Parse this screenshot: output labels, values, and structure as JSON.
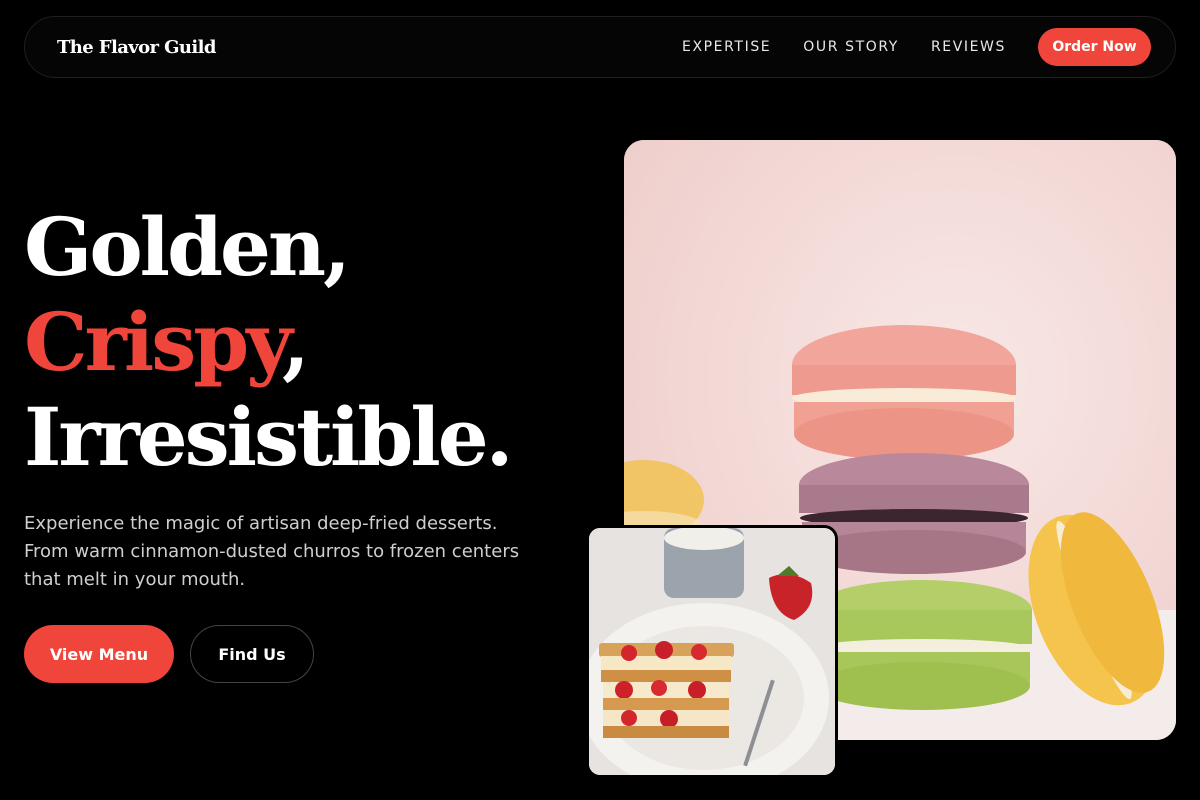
{
  "brand": "The Flavor Guild",
  "nav": {
    "links": [
      "EXPERTISE",
      "OUR STORY",
      "REVIEWS"
    ],
    "cta": "Order Now"
  },
  "hero": {
    "line1": "Golden,",
    "line2_accent": "Crispy",
    "line2_rest": ",",
    "line3": "Irresistible.",
    "lead": "Experience the magic of artisan deep-fried desserts. From warm cinnamon-dusted churros to frozen centers that melt in your mouth.",
    "primary_button": "View Menu",
    "secondary_button": "Find Us"
  },
  "images": {
    "main": "macarons-stack-image",
    "secondary": "strawberry-mille-feuille-image"
  },
  "colors": {
    "accent": "#f0453a",
    "background": "#000000",
    "text": "#ffffff",
    "muted_text": "#cfcfcf"
  }
}
